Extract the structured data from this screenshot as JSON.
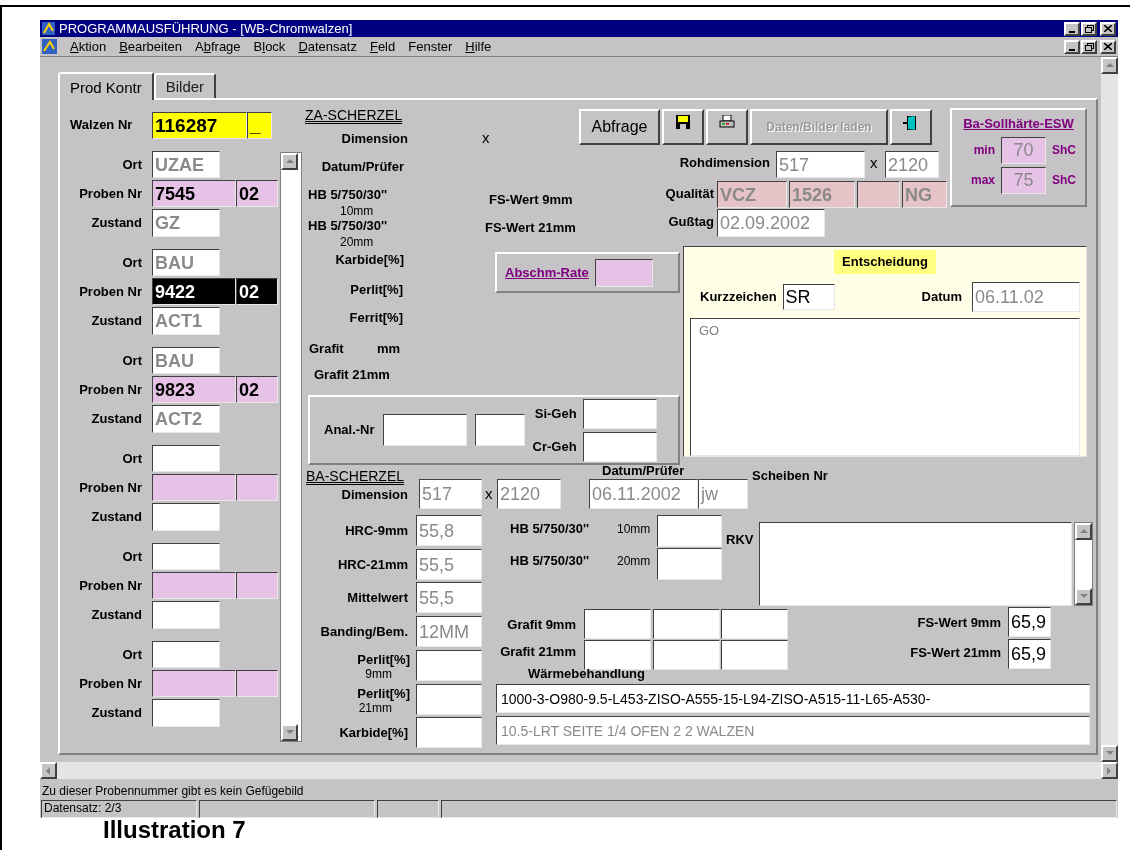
{
  "document": {
    "caption": "Illustration 7"
  },
  "window": {
    "title": "PROGRAMMAUSFÜHRUNG - [WB-Chromwalzen]"
  },
  "menu": [
    {
      "key": "A",
      "post": "ktion"
    },
    {
      "key": "B",
      "post": "earbeiten"
    },
    {
      "pre": "A",
      "key": "b",
      "post": "frage"
    },
    {
      "pre": "B",
      "key": "l",
      "post": "ock"
    },
    {
      "key": "D",
      "post": "atensatz"
    },
    {
      "key": "F",
      "post": "eld"
    },
    {
      "pre": "Fenster"
    },
    {
      "key": "H",
      "post": "ilfe"
    }
  ],
  "tabs": [
    {
      "label": "Prod Kontr",
      "selected": true
    },
    {
      "label": "Bilder",
      "selected": false
    }
  ],
  "walzen": {
    "label": "Walzen Nr",
    "value": "116287",
    "suffix": "_"
  },
  "proben": [
    {
      "ort_label": "Ort",
      "ort": "UZAE",
      "nr_label": "Proben Nr",
      "nr": "7545",
      "lfd": "02",
      "zustand_label": "Zustand",
      "zustand": "GZ",
      "selected": false
    },
    {
      "ort_label": "Ort",
      "ort": "BAU",
      "nr_label": "Proben Nr",
      "nr": "9422",
      "lfd": "02",
      "zustand_label": "Zustand",
      "zustand": "ACT1",
      "selected": true
    },
    {
      "ort_label": "Ort",
      "ort": "BAU",
      "nr_label": "Proben Nr",
      "nr": "9823",
      "lfd": "02",
      "zustand_label": "Zustand",
      "zustand": "ACT2",
      "selected": false
    },
    {
      "ort_label": "Ort",
      "nr_label": "Proben Nr",
      "zustand_label": "Zustand",
      "selected": false
    },
    {
      "ort_label": "Ort",
      "nr_label": "Proben Nr",
      "zustand_label": "Zustand",
      "selected": false
    },
    {
      "ort_label": "Ort",
      "nr_label": "Proben Nr",
      "zustand_label": "Zustand",
      "selected": false
    }
  ],
  "za_scherzel": {
    "heading": "ZA-SCHERZEL",
    "dimension_label": "Dimension",
    "times": "x",
    "datum_label": "Datum/Prüfer",
    "hb10_label": "HB 5/750/30''",
    "hb10_unit": "10mm",
    "hb20_label": "HB 5/750/30''",
    "hb20_unit": "20mm",
    "karbide_label": "Karbide[%]",
    "perlit_label": "Perlit[%]",
    "ferrit_label": "Ferrit[%]",
    "grafit_label": "Grafit",
    "grafit_unit": "mm",
    "grafit21_label": "Grafit 21mm",
    "fs9_label": "FS-Wert 9mm",
    "fs21_label": "FS-Wert 21mm"
  },
  "analyse": {
    "nr_label": "Anal.-Nr",
    "si_label": "Si-Geh",
    "cr_label": "Cr-Geh"
  },
  "abschm": {
    "link": "Abschm-Rate"
  },
  "toolbar": [
    {
      "kind": "text",
      "label": "Abfrage",
      "disabled": false
    },
    {
      "kind": "save",
      "disabled": false
    },
    {
      "kind": "print",
      "disabled": false
    },
    {
      "kind": "text",
      "label": "Daten/Bilder laden",
      "disabled": true
    },
    {
      "kind": "exit",
      "disabled": false
    }
  ],
  "sollhaerte": {
    "link": "Ba-Sollhärte-ESW",
    "min_label": "min",
    "min": "70",
    "min_unit": "ShC",
    "max_label": "max",
    "max": "75",
    "max_unit": "ShC"
  },
  "rohdimension": {
    "label": "Rohdimension",
    "a": "517",
    "times": "x",
    "b": "2120"
  },
  "qualitaet": {
    "label": "Qualität",
    "grade": "VCZ",
    "number": "1526",
    "suffix": "NG"
  },
  "gusstag": {
    "label": "Gußtag",
    "value": "02.09.2002"
  },
  "entscheidung": {
    "title": "Entscheidung",
    "kurz_label": "Kurzzeichen",
    "kurz": {
      "value": "SR",
      "readonly": false
    },
    "datum_label": "Datum",
    "datum": {
      "value": "06.11.02",
      "readonly": true
    },
    "bemerkung": "GO"
  },
  "ba_scherzel": {
    "heading": "BA-SCHERZEL",
    "dimension_label": "Dimension",
    "dim_a": "517",
    "times": "x",
    "dim_b": "2120",
    "datum_label": "Datum/Prüfer",
    "datum": "06.11.2002",
    "pruefer": "jw",
    "scheiben_label": "Scheiben Nr",
    "rows": [
      {
        "label": "HRC-9mm",
        "value": "55,8"
      },
      {
        "label": "HRC-21mm",
        "value": "55,5"
      },
      {
        "label": "Mittelwert",
        "value": "55,5"
      },
      {
        "label": "Banding/Bem.",
        "value": "12MM"
      },
      {
        "label": "Perlit[%]",
        "unit": "9mm"
      },
      {
        "label": "Perlit[%]",
        "unit": "21mm"
      },
      {
        "label": "Karbide[%]"
      }
    ],
    "hb": [
      {
        "label": "HB 5/750/30''",
        "unit": "10mm"
      },
      {
        "label": "HB 5/750/30''",
        "unit": "20mm"
      }
    ],
    "rkv_label": "RKV",
    "grafit": [
      {
        "label": "Grafit 9mm"
      },
      {
        "label": "Grafit 21mm"
      }
    ],
    "fs": [
      {
        "label": "FS-Wert 9mm",
        "value": "65,9",
        "readonly": false
      },
      {
        "label": "FS-Wert 21mm",
        "value": "65,9",
        "readonly": false
      }
    ],
    "waerme_label": "Wärmebehandlung",
    "waerme": [
      {
        "value": "1000-3-O980-9.5-L453-ZISO-A555-15-L94-ZISO-A515-11-L65-A530-",
        "readonly": false
      },
      {
        "value": "10.5-LRT SEITE 1/4 OFEN 2 2 WALZEN",
        "readonly": true
      }
    ]
  },
  "status": {
    "message": "Zu dieser Probennummer gibt es kein Gefügebild",
    "record": "Datensatz: 2/3"
  }
}
